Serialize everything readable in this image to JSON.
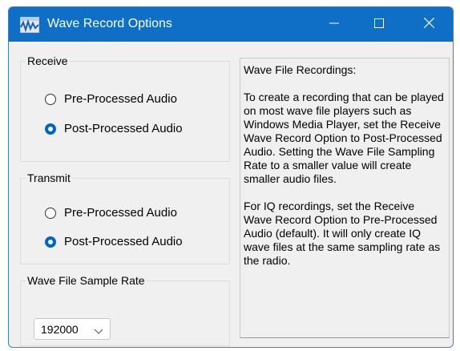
{
  "window": {
    "title": "Wave Record Options",
    "title_bar_color": "#0f6fc6",
    "icons": {
      "app": "audio-waveform-icon",
      "minimize": "minimize-icon",
      "maximize": "maximize-icon",
      "close": "close-icon"
    }
  },
  "receive": {
    "label": "Receive",
    "options": [
      {
        "label": "Pre-Processed Audio",
        "checked": false
      },
      {
        "label": "Post-Processed Audio",
        "checked": true
      }
    ]
  },
  "transmit": {
    "label": "Transmit",
    "options": [
      {
        "label": "Pre-Processed Audio",
        "checked": false
      },
      {
        "label": "Post-Processed Audio",
        "checked": true
      }
    ]
  },
  "sample_rate": {
    "label": "Wave File Sample Rate",
    "value": "192000"
  },
  "info": {
    "heading": "Wave File Recordings:",
    "paragraph1": "To create a recording that can be played on most wave file players such as Windows Media Player, set the Receive Wave Record Option to Post-Processed Audio.  Setting the Wave File Sampling Rate to a smaller value will create smaller audio files.",
    "paragraph2": "For IQ recordings, set the Receive Wave Record Option to Pre-Processed Audio (default).  It will only create IQ wave files at the same sampling rate as the radio."
  },
  "colors": {
    "accent": "#0067c0",
    "window_bg": "#f0f0f0"
  }
}
